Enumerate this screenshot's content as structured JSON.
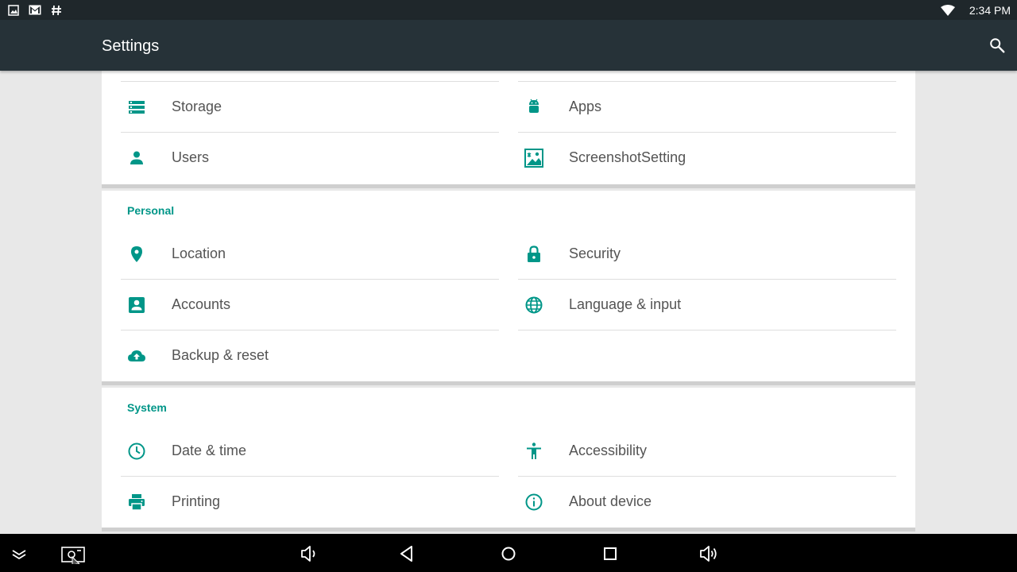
{
  "status_bar": {
    "time": "2:34 PM",
    "left_icons": [
      "gallery-icon",
      "gmail-icon",
      "hashtag-icon"
    ],
    "right_icons": [
      "wifi-icon"
    ]
  },
  "app_bar": {
    "title": "Settings",
    "search_icon": "search-icon"
  },
  "colors": {
    "accent": "#009688",
    "app_bar": "#263238",
    "status_bar": "#1f272b",
    "text": "#545454"
  },
  "sections": {
    "device": {
      "items": [
        {
          "label": "Storage",
          "icon": "storage-icon"
        },
        {
          "label": "Apps",
          "icon": "android-icon"
        },
        {
          "label": "Users",
          "icon": "person-icon"
        },
        {
          "label": "ScreenshotSetting",
          "icon": "screenshot-image-icon"
        }
      ]
    },
    "personal": {
      "title": "Personal",
      "items": [
        {
          "label": "Location",
          "icon": "location-pin-icon"
        },
        {
          "label": "Security",
          "icon": "lock-icon"
        },
        {
          "label": "Accounts",
          "icon": "account-box-icon"
        },
        {
          "label": "Language & input",
          "icon": "globe-icon"
        },
        {
          "label": "Backup & reset",
          "icon": "cloud-upload-icon"
        }
      ]
    },
    "system": {
      "title": "System",
      "items": [
        {
          "label": "Date & time",
          "icon": "clock-icon"
        },
        {
          "label": "Accessibility",
          "icon": "accessibility-icon"
        },
        {
          "label": "Printing",
          "icon": "printer-icon"
        },
        {
          "label": "About device",
          "icon": "info-icon"
        }
      ]
    }
  },
  "nav_bar": {
    "buttons": [
      "collapse-icon",
      "screenshot-icon",
      "volume-down-icon",
      "back-icon",
      "home-icon",
      "recents-icon",
      "volume-up-icon"
    ]
  }
}
